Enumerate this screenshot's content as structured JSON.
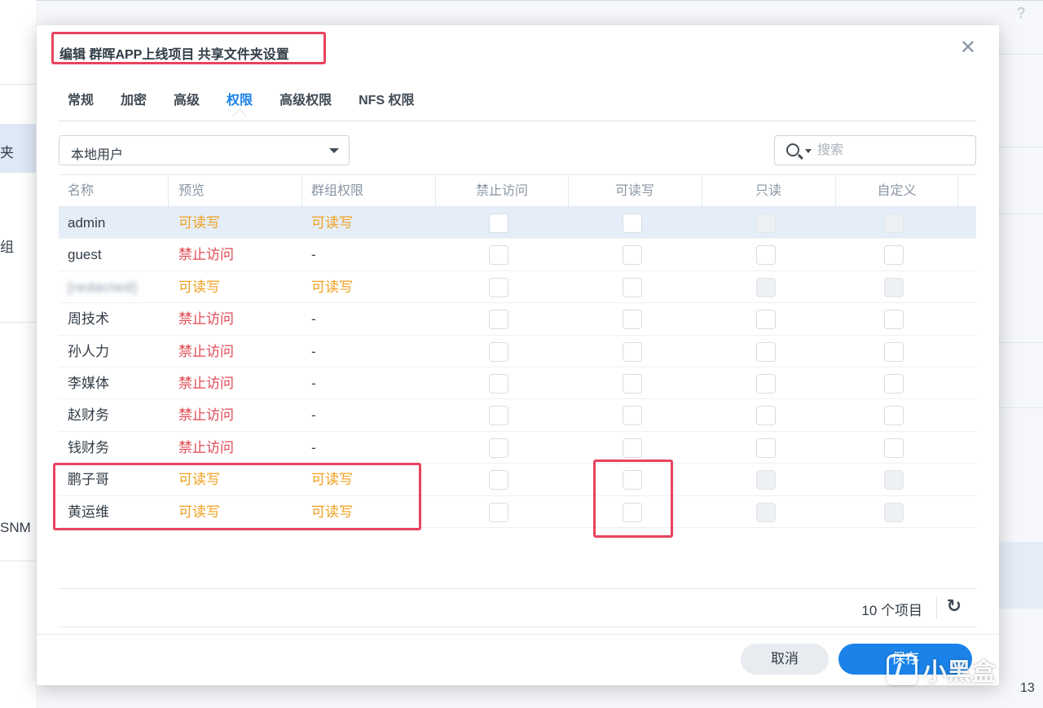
{
  "background": {
    "sidebar_items": [
      "夹",
      "组",
      "SNM"
    ],
    "help_icon": "?",
    "page_number": "13"
  },
  "dialog": {
    "title": "编辑 群晖APP上线项目 共享文件夹设置",
    "tabs": [
      "常规",
      "加密",
      "高级",
      "权限",
      "高级权限",
      "NFS 权限"
    ],
    "active_tab": "权限",
    "user_type_select": "本地用户",
    "search_placeholder": "搜索",
    "columns": [
      "名称",
      "预览",
      "群组权限",
      "禁止访问",
      "可读写",
      "只读",
      "自定义"
    ],
    "rows": [
      {
        "name": "admin",
        "preview": "可读写",
        "group": "可读写",
        "preview_type": "rw",
        "group_type": "rw",
        "deny": false,
        "rw": false,
        "ro": false,
        "custom": false,
        "ro_disabled": true,
        "custom_disabled": true,
        "selected": true
      },
      {
        "name": "guest",
        "preview": "禁止访问",
        "group": "-",
        "preview_type": "deny",
        "group_type": "none",
        "deny": false,
        "rw": false,
        "ro": false,
        "custom": false,
        "ro_disabled": false,
        "custom_disabled": false,
        "selected": false
      },
      {
        "name": "[redacted]",
        "preview": "可读写",
        "group": "可读写",
        "preview_type": "rw",
        "group_type": "rw",
        "deny": false,
        "rw": false,
        "ro": false,
        "custom": false,
        "ro_disabled": true,
        "custom_disabled": true,
        "selected": false,
        "blurred": true
      },
      {
        "name": "周技术",
        "preview": "禁止访问",
        "group": "-",
        "preview_type": "deny",
        "group_type": "none",
        "deny": false,
        "rw": false,
        "ro": false,
        "custom": false,
        "ro_disabled": false,
        "custom_disabled": false,
        "selected": false
      },
      {
        "name": "孙人力",
        "preview": "禁止访问",
        "group": "-",
        "preview_type": "deny",
        "group_type": "none",
        "deny": false,
        "rw": false,
        "ro": false,
        "custom": false,
        "ro_disabled": false,
        "custom_disabled": false,
        "selected": false
      },
      {
        "name": "李媒体",
        "preview": "禁止访问",
        "group": "-",
        "preview_type": "deny",
        "group_type": "none",
        "deny": false,
        "rw": false,
        "ro": false,
        "custom": false,
        "ro_disabled": false,
        "custom_disabled": false,
        "selected": false
      },
      {
        "name": "赵财务",
        "preview": "禁止访问",
        "group": "-",
        "preview_type": "deny",
        "group_type": "none",
        "deny": false,
        "rw": false,
        "ro": false,
        "custom": false,
        "ro_disabled": false,
        "custom_disabled": false,
        "selected": false
      },
      {
        "name": "钱财务",
        "preview": "禁止访问",
        "group": "-",
        "preview_type": "deny",
        "group_type": "none",
        "deny": false,
        "rw": false,
        "ro": false,
        "custom": false,
        "ro_disabled": false,
        "custom_disabled": false,
        "selected": false
      },
      {
        "name": "鹏子哥",
        "preview": "可读写",
        "group": "可读写",
        "preview_type": "rw",
        "group_type": "rw",
        "deny": false,
        "rw": false,
        "ro": false,
        "custom": false,
        "ro_disabled": true,
        "custom_disabled": true,
        "selected": false
      },
      {
        "name": "黄运维",
        "preview": "可读写",
        "group": "可读写",
        "preview_type": "rw",
        "group_type": "rw",
        "deny": false,
        "rw": false,
        "ro": false,
        "custom": false,
        "ro_disabled": true,
        "custom_disabled": true,
        "selected": false
      }
    ],
    "item_count": "10 个项目",
    "cancel_label": "取消",
    "save_label": "保存"
  },
  "watermark": "小黑盒",
  "colors": {
    "accent": "#1a82e8",
    "perm_rw": "#f0a020",
    "perm_deny": "#e04a52",
    "highlight": "#e8435d"
  }
}
